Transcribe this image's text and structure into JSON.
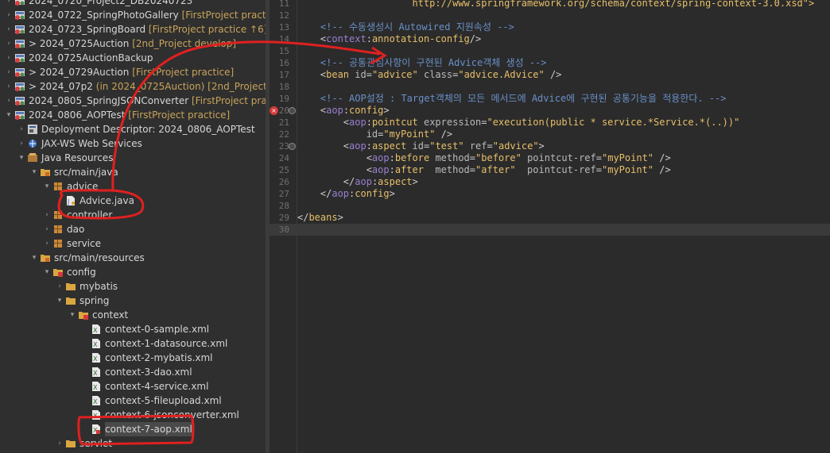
{
  "explorer": {
    "rows": [
      {
        "id": "r0",
        "level": 0,
        "arrow": "right",
        "icon": "project",
        "label": "2024_0720_Project2_DB20240723",
        "dec": ""
      },
      {
        "id": "r1",
        "level": 0,
        "arrow": "right",
        "icon": "project",
        "label": "2024_0722_SpringPhotoGallery",
        "dec": "[FirstProject practice"
      },
      {
        "id": "r2",
        "level": 0,
        "arrow": "right",
        "icon": "project",
        "label": "2024_0723_SpringBoard",
        "dec": "[FirstProject practice ↑6]"
      },
      {
        "id": "r3",
        "level": 0,
        "arrow": "right",
        "icon": "project",
        "label": "> 2024_0725Auction",
        "dec": "[2nd_Project develop]"
      },
      {
        "id": "r4",
        "level": 0,
        "arrow": "right",
        "icon": "project",
        "label": "2024_0725AuctionBackup",
        "dec": ""
      },
      {
        "id": "r5",
        "level": 0,
        "arrow": "right",
        "icon": "project",
        "label": "> 2024_0729Auction",
        "dec": "[FirstProject practice]"
      },
      {
        "id": "r6",
        "level": 0,
        "arrow": "right",
        "icon": "project",
        "label": "> 2024_07p2",
        "dec": "(in 2024_0725Auction) [2nd_Project de"
      },
      {
        "id": "r7",
        "level": 0,
        "arrow": "right",
        "icon": "project",
        "label": "2024_0805_SpringJSONConverter",
        "dec": "[FirstProject practic"
      },
      {
        "id": "r8",
        "level": 0,
        "arrow": "down",
        "icon": "project",
        "label": "2024_0806_AOPTest",
        "dec": "[FirstProject practice]"
      },
      {
        "id": "r9",
        "level": 1,
        "arrow": "right",
        "icon": "descriptor",
        "label": "Deployment Descriptor: 2024_0806_AOPTest",
        "dec": ""
      },
      {
        "id": "r10",
        "level": 1,
        "arrow": "right",
        "icon": "ws",
        "label": "JAX-WS Web Services",
        "dec": ""
      },
      {
        "id": "r11",
        "level": 1,
        "arrow": "down",
        "icon": "jres",
        "label": "Java Resources",
        "dec": ""
      },
      {
        "id": "r12",
        "level": 2,
        "arrow": "down",
        "icon": "srcfolder",
        "label": "src/main/java",
        "dec": ""
      },
      {
        "id": "r13",
        "level": 3,
        "arrow": "down",
        "icon": "package",
        "label": "advice",
        "dec": ""
      },
      {
        "id": "r14",
        "level": 4,
        "arrow": "right",
        "icon": "javafile",
        "label": "Advice.java",
        "dec": ""
      },
      {
        "id": "r15",
        "level": 3,
        "arrow": "right",
        "icon": "package",
        "label": "controller",
        "dec": ""
      },
      {
        "id": "r16",
        "level": 3,
        "arrow": "right",
        "icon": "package",
        "label": "dao",
        "dec": ""
      },
      {
        "id": "r17",
        "level": 3,
        "arrow": "right",
        "icon": "package",
        "label": "service",
        "dec": ""
      },
      {
        "id": "r18",
        "level": 2,
        "arrow": "down",
        "icon": "srcfolder",
        "label": "src/main/resources",
        "dec": ""
      },
      {
        "id": "r19",
        "level": 3,
        "arrow": "down",
        "icon": "folder-x",
        "label": "config",
        "dec": ""
      },
      {
        "id": "r20",
        "level": 4,
        "arrow": "right",
        "icon": "folder",
        "label": "mybatis",
        "dec": ""
      },
      {
        "id": "r21",
        "level": 4,
        "arrow": "down",
        "icon": "folder",
        "label": "spring",
        "dec": ""
      },
      {
        "id": "r22",
        "level": 5,
        "arrow": "down",
        "icon": "folder-x",
        "label": "context",
        "dec": ""
      },
      {
        "id": "r23",
        "level": 6,
        "arrow": "none",
        "icon": "xmlfile",
        "label": "context-0-sample.xml",
        "dec": ""
      },
      {
        "id": "r24",
        "level": 6,
        "arrow": "none",
        "icon": "xmlfile",
        "label": "context-1-datasource.xml",
        "dec": ""
      },
      {
        "id": "r25",
        "level": 6,
        "arrow": "none",
        "icon": "xmlfile",
        "label": "context-2-mybatis.xml",
        "dec": ""
      },
      {
        "id": "r26",
        "level": 6,
        "arrow": "none",
        "icon": "xmlfile",
        "label": "context-3-dao.xml",
        "dec": ""
      },
      {
        "id": "r27",
        "level": 6,
        "arrow": "none",
        "icon": "xmlfile",
        "label": "context-4-service.xml",
        "dec": ""
      },
      {
        "id": "r28",
        "level": 6,
        "arrow": "none",
        "icon": "xmlfile",
        "label": "context-5-fileupload.xml",
        "dec": ""
      },
      {
        "id": "r29",
        "level": 6,
        "arrow": "none",
        "icon": "xmlfile",
        "label": "context-6-jsonconverter.xml",
        "dec": ""
      },
      {
        "id": "r30",
        "level": 6,
        "arrow": "none",
        "icon": "xmlfile-err",
        "label": "context-7-aop.xml",
        "dec": "",
        "selected": true
      },
      {
        "id": "r31",
        "level": 4,
        "arrow": "right",
        "icon": "folder",
        "label": "servlet",
        "dec": ""
      }
    ]
  },
  "editor": {
    "lines": [
      {
        "n": "11",
        "tokens": [
          [
            "plain",
            "                    "
          ],
          [
            "url",
            "http://www.springframework.org/schema/context/spring-context-3.0.xsd\">"
          ]
        ]
      },
      {
        "n": "12",
        "tokens": []
      },
      {
        "n": "13",
        "tokens": [
          [
            "cmt",
            "    <!-- 수동생성시 Autowired 지원속성 -->"
          ]
        ]
      },
      {
        "n": "14",
        "tokens": [
          [
            "plain",
            "    <"
          ],
          [
            "pfx",
            "context"
          ],
          [
            "plain",
            ":"
          ],
          [
            "tag",
            "annotation-config"
          ],
          [
            "plain",
            "/>"
          ]
        ]
      },
      {
        "n": "15",
        "tokens": []
      },
      {
        "n": "16",
        "tokens": [
          [
            "cmt",
            "    <!-- 공통관심사항이 구현된 Advice객체 생성 -->"
          ]
        ]
      },
      {
        "n": "17",
        "tokens": [
          [
            "plain",
            "    <"
          ],
          [
            "tag",
            "bean"
          ],
          [
            "plain",
            " "
          ],
          [
            "attr",
            "id"
          ],
          [
            "plain",
            "="
          ],
          [
            "val",
            "\"advice\""
          ],
          [
            "plain",
            " "
          ],
          [
            "attr",
            "class"
          ],
          [
            "plain",
            "="
          ],
          [
            "val",
            "\"advice.Advice\""
          ],
          [
            "plain",
            " />"
          ]
        ]
      },
      {
        "n": "18",
        "tokens": []
      },
      {
        "n": "19",
        "tokens": [
          [
            "cmt",
            "    <!-- AOP설정 : Target객체의 모든 메서드에 Advice에 구현된 공통기능을 적용한다. -->"
          ]
        ]
      },
      {
        "n": "20",
        "tokens": [
          [
            "plain",
            "    <"
          ],
          [
            "pfx",
            "aop"
          ],
          [
            "plain",
            ":"
          ],
          [
            "tag",
            "config"
          ],
          [
            "plain",
            ">"
          ]
        ],
        "err": true,
        "fold": true
      },
      {
        "n": "21",
        "tokens": [
          [
            "plain",
            "        <"
          ],
          [
            "pfx",
            "aop"
          ],
          [
            "plain",
            ":"
          ],
          [
            "tag",
            "pointcut"
          ],
          [
            "plain",
            " "
          ],
          [
            "attr",
            "expression"
          ],
          [
            "plain",
            "="
          ],
          [
            "val",
            "\"execution(public * service.*Service.*(..))\""
          ]
        ]
      },
      {
        "n": "22",
        "tokens": [
          [
            "plain",
            "            "
          ],
          [
            "attr",
            "id"
          ],
          [
            "plain",
            "="
          ],
          [
            "val",
            "\"myPoint\""
          ],
          [
            "plain",
            " />"
          ]
        ]
      },
      {
        "n": "23",
        "tokens": [
          [
            "plain",
            "        <"
          ],
          [
            "pfx",
            "aop"
          ],
          [
            "plain",
            ":"
          ],
          [
            "tag",
            "aspect"
          ],
          [
            "plain",
            " "
          ],
          [
            "attr",
            "id"
          ],
          [
            "plain",
            "="
          ],
          [
            "val",
            "\"test\""
          ],
          [
            "plain",
            " "
          ],
          [
            "attr",
            "ref"
          ],
          [
            "plain",
            "="
          ],
          [
            "val",
            "\"advice\""
          ],
          [
            "plain",
            ">"
          ]
        ],
        "fold": true
      },
      {
        "n": "24",
        "tokens": [
          [
            "plain",
            "            <"
          ],
          [
            "pfx",
            "aop"
          ],
          [
            "plain",
            ":"
          ],
          [
            "tag",
            "before"
          ],
          [
            "plain",
            " "
          ],
          [
            "attr",
            "method"
          ],
          [
            "plain",
            "="
          ],
          [
            "val",
            "\"before\""
          ],
          [
            "plain",
            " "
          ],
          [
            "attr",
            "pointcut-ref"
          ],
          [
            "plain",
            "="
          ],
          [
            "val",
            "\"myPoint\""
          ],
          [
            "plain",
            " />"
          ]
        ]
      },
      {
        "n": "25",
        "tokens": [
          [
            "plain",
            "            <"
          ],
          [
            "pfx",
            "aop"
          ],
          [
            "plain",
            ":"
          ],
          [
            "tag",
            "after"
          ],
          [
            "plain",
            "  "
          ],
          [
            "attr",
            "method"
          ],
          [
            "plain",
            "="
          ],
          [
            "val",
            "\"after\""
          ],
          [
            "plain",
            "  "
          ],
          [
            "attr",
            "pointcut-ref"
          ],
          [
            "plain",
            "="
          ],
          [
            "val",
            "\"myPoint\""
          ],
          [
            "plain",
            " />"
          ]
        ]
      },
      {
        "n": "26",
        "tokens": [
          [
            "plain",
            "        </"
          ],
          [
            "pfx",
            "aop"
          ],
          [
            "plain",
            ":"
          ],
          [
            "tag",
            "aspect"
          ],
          [
            "plain",
            ">"
          ]
        ]
      },
      {
        "n": "27",
        "tokens": [
          [
            "plain",
            "    </"
          ],
          [
            "pfx",
            "aop"
          ],
          [
            "plain",
            ":"
          ],
          [
            "tag",
            "config"
          ],
          [
            "plain",
            ">"
          ]
        ]
      },
      {
        "n": "28",
        "tokens": []
      },
      {
        "n": "29",
        "tokens": [
          [
            "plain",
            "</"
          ],
          [
            "tag",
            "beans"
          ],
          [
            "plain",
            ">"
          ]
        ]
      },
      {
        "n": "30",
        "tokens": [],
        "current": true
      }
    ]
  },
  "colors": {
    "annotation": "#e02020",
    "decoration": "#c8a35a",
    "explorer_bg": "#2f2f2f",
    "editor_bg": "#2b2b2b"
  }
}
